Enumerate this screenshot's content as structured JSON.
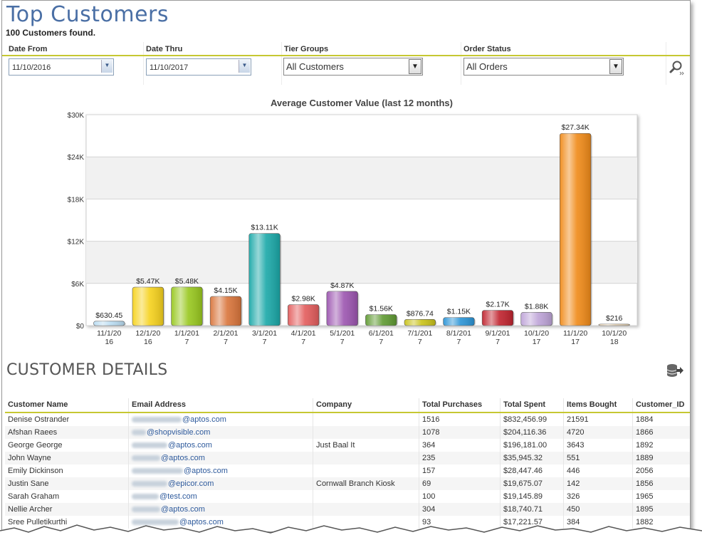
{
  "header": {
    "title": "Top Customers",
    "count_text": "100 Customers found."
  },
  "filters": {
    "date_from": {
      "label": "Date From",
      "value": "11/10/2016"
    },
    "date_thru": {
      "label": "Date Thru",
      "value": "11/10/2017"
    },
    "tier_groups": {
      "label": "Tier Groups",
      "value": "All Customers"
    },
    "order_status": {
      "label": "Order Status",
      "value": "All Orders"
    }
  },
  "chart_data": {
    "type": "bar",
    "title": "Average Customer Value (last 12 months)",
    "categories": [
      "11/1/2016",
      "12/1/2016",
      "1/1/2017",
      "2/1/2017",
      "3/1/2017",
      "4/1/2017",
      "5/1/2017",
      "6/1/2017",
      "7/1/2017",
      "8/1/2017",
      "9/1/2017",
      "10/1/2017",
      "11/1/2017",
      "10/1/2018"
    ],
    "tick_labels": [
      [
        "11/1/20",
        "16"
      ],
      [
        "12/1/20",
        "16"
      ],
      [
        "1/1/201",
        "7"
      ],
      [
        "2/1/201",
        "7"
      ],
      [
        "3/1/201",
        "7"
      ],
      [
        "4/1/201",
        "7"
      ],
      [
        "5/1/201",
        "7"
      ],
      [
        "6/1/201",
        "7"
      ],
      [
        "7/1/201",
        "7"
      ],
      [
        "8/1/201",
        "7"
      ],
      [
        "9/1/201",
        "7"
      ],
      [
        "10/1/20",
        "17"
      ],
      [
        "11/1/20",
        "17"
      ],
      [
        "10/1/20",
        "18"
      ]
    ],
    "values": [
      630.45,
      5470,
      5480,
      4150,
      13110,
      2980,
      4870,
      1560,
      876.74,
      1150,
      2170,
      1880,
      27340,
      216
    ],
    "data_labels": [
      "$630.45",
      "$5.47K",
      "$5.48K",
      "$4.15K",
      "$13.11K",
      "$2.98K",
      "$4.87K",
      "$1.56K",
      "$876.74",
      "$1.15K",
      "$2.17K",
      "$1.88K",
      "$27.34K",
      "$216"
    ],
    "colors": [
      "#b9dcf2",
      "#f6d21c",
      "#98c81e",
      "#d9743a",
      "#1aa8a8",
      "#e35c5c",
      "#9c55b0",
      "#5f9a32",
      "#c9c218",
      "#2a94d6",
      "#c0232e",
      "#bea4d8",
      "#f08a18",
      "#eed9b8"
    ],
    "ylim": [
      0,
      30000
    ],
    "yticks": [
      "$0",
      "$6K",
      "$12K",
      "$18K",
      "$24K",
      "$30K"
    ],
    "ytick_values": [
      0,
      6000,
      12000,
      18000,
      24000,
      30000
    ],
    "grid": true,
    "xlabel": "",
    "ylabel": ""
  },
  "details": {
    "title": "CUSTOMER DETAILS",
    "columns": [
      "Customer Name",
      "Email Address",
      "Company",
      "Total Purchases",
      "Total Spent",
      "Items Bought",
      "Customer_ID"
    ],
    "rows": [
      {
        "name": "Denise Ostrander",
        "email": "@aptos.com",
        "company": "",
        "purchases": "1516",
        "spent": "$832,456.99",
        "items": "21591",
        "id": "1884"
      },
      {
        "name": "Afshan Raees",
        "email": "@shopvisible.com",
        "company": "",
        "purchases": "1078",
        "spent": "$204,116.36",
        "items": "4720",
        "id": "1866"
      },
      {
        "name": "George George",
        "email": "@aptos.com",
        "company": "Just Baal It",
        "purchases": "364",
        "spent": "$196,181.00",
        "items": "3643",
        "id": "1892"
      },
      {
        "name": "John Wayne",
        "email": "@aptos.com",
        "company": "",
        "purchases": "235",
        "spent": "$35,945.32",
        "items": "551",
        "id": "1889"
      },
      {
        "name": "Emily Dickinson",
        "email": "@aptos.com",
        "company": "",
        "purchases": "157",
        "spent": "$28,447.46",
        "items": "446",
        "id": "2056"
      },
      {
        "name": "Justin Sane",
        "email": "@epicor.com",
        "company": "Cornwall Branch Kiosk",
        "purchases": "69",
        "spent": "$19,675.07",
        "items": "142",
        "id": "1856"
      },
      {
        "name": "Sarah Graham",
        "email": "@test.com",
        "company": "",
        "purchases": "100",
        "spent": "$19,145.89",
        "items": "326",
        "id": "1965"
      },
      {
        "name": "Nellie Archer",
        "email": "@aptos.com",
        "company": "",
        "purchases": "304",
        "spent": "$18,740.71",
        "items": "450",
        "id": "1895"
      },
      {
        "name": "Sree Pulletikurthi",
        "email": "@aptos.com",
        "company": "",
        "purchases": "93",
        "spent": "$17,221.57",
        "items": "384",
        "id": "1882"
      }
    ]
  }
}
